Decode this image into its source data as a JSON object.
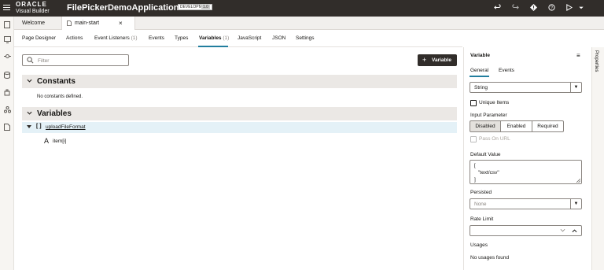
{
  "header": {
    "brand_line1": "ORACLE",
    "brand_line2": "Visual Builder",
    "app_title": "FilePickerDemoApplication",
    "env_badge": "DEVELOPMENT",
    "version_badge": "1.0",
    "icons": [
      "hamburger-icon",
      "undo-icon",
      "redo-icon",
      "audits-icon",
      "help-icon",
      "preview-icon",
      "user-icon"
    ]
  },
  "left_rail": {
    "icons": [
      "pages-icon",
      "monitor-icon",
      "network-icon",
      "database-icon",
      "component-icon",
      "processes-icon",
      "source-icon"
    ]
  },
  "editor_tabs": [
    {
      "label": "Welcome"
    },
    {
      "label": "main-start",
      "close": "×"
    }
  ],
  "sub_tabs": [
    {
      "label": "Page Designer",
      "count": ""
    },
    {
      "label": "Actions",
      "count": ""
    },
    {
      "label": "Event Listeners",
      "count": "(1)"
    },
    {
      "label": "Events",
      "count": ""
    },
    {
      "label": "Types",
      "count": ""
    },
    {
      "label": "Variables",
      "count": "(1)",
      "active": true
    },
    {
      "label": "JavaScript",
      "count": ""
    },
    {
      "label": "JSON",
      "count": ""
    },
    {
      "label": "Settings",
      "count": ""
    }
  ],
  "filter": {
    "placeholder": "Filter"
  },
  "add_variable": {
    "label": "Variable"
  },
  "constants": {
    "title": "Constants",
    "empty_text": "No constants defined."
  },
  "variables": {
    "title": "Variables",
    "items": [
      {
        "name": "uploadFileFormat",
        "type_glyph": "[ ]"
      },
      {
        "name": "item[i]",
        "type_glyph": "A"
      }
    ]
  },
  "properties": {
    "title": "Variable",
    "tabs": [
      "General",
      "Events"
    ],
    "type_value": "String",
    "unique_items": "Unique Items",
    "input_parameter": "Input Parameter",
    "input_options": [
      "Disabled",
      "Enabled",
      "Required"
    ],
    "input_selected": "Disabled",
    "pass_on_url": "Pass On URL",
    "default_value_label": "Default Value",
    "default_value_lines": [
      "[",
      "\"text/csv\"",
      "]"
    ],
    "persisted_label": "Persisted",
    "persisted_value": "None",
    "rate_limit_label": "Rate Limit",
    "usages_label": "Usages",
    "usages_text": "No usages found",
    "side_tab": "Properties"
  }
}
